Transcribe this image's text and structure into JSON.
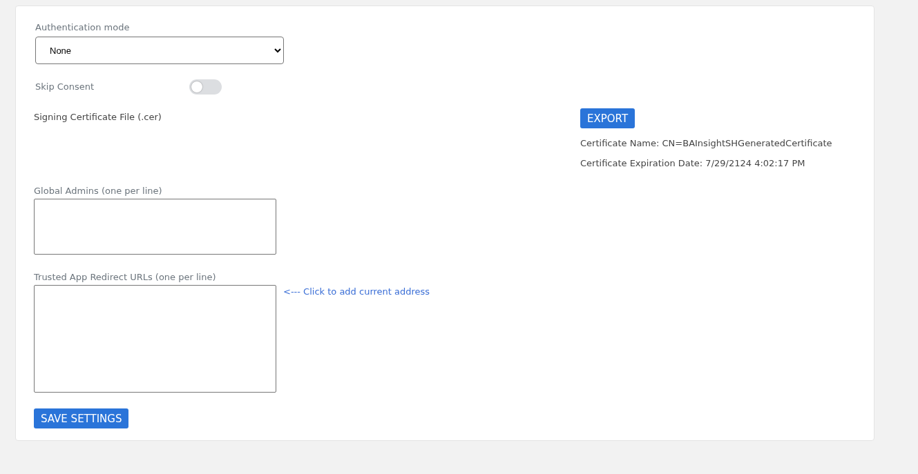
{
  "authentication_mode": {
    "label": "Authentication mode",
    "value": "None"
  },
  "skip_consent": {
    "label": "Skip Consent",
    "on": false
  },
  "signing_certificate": {
    "label": "Signing Certificate File (.cer)",
    "export_button": "EXPORT",
    "certificate_name": "Certificate Name: CN=BAInsightSHGeneratedCertificate",
    "expiration_date": "Certificate Expiration Date: 7/29/2124 4:02:17 PM"
  },
  "global_admins": {
    "label": "Global Admins (one per line)"
  },
  "trusted_redirect_urls": {
    "label": "Trusted App Redirect URLs (one per line)",
    "add_link": "<--- Click to add current address"
  },
  "save_button": "SAVE SETTINGS"
}
